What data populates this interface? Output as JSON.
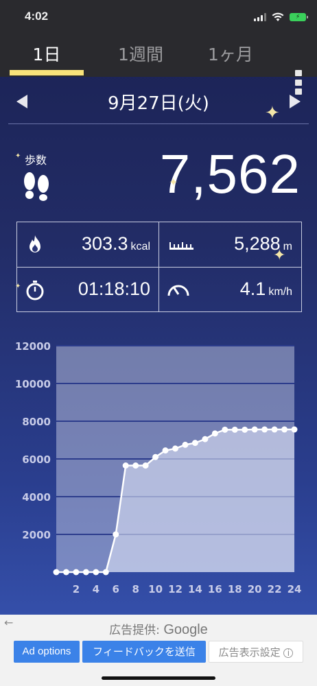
{
  "status_bar": {
    "time": "4:02"
  },
  "tabs": [
    {
      "label": "1日",
      "active": true
    },
    {
      "label": "1週間",
      "active": false
    },
    {
      "label": "1ヶ月",
      "active": false
    }
  ],
  "date": {
    "label": "9月27日(火)"
  },
  "steps": {
    "label": "歩数",
    "value": "7,562"
  },
  "stats": {
    "calories": {
      "value": "303.3",
      "unit": "kcal"
    },
    "distance": {
      "value": "5,288",
      "unit": "m"
    },
    "duration": {
      "value": "01:18:10"
    },
    "speed": {
      "value": "4.1",
      "unit": "km/h"
    }
  },
  "chart_data": {
    "type": "area",
    "x": [
      0,
      1,
      2,
      3,
      4,
      5,
      6,
      7,
      8,
      9,
      10,
      11,
      12,
      13,
      14,
      15,
      16,
      17,
      18,
      19,
      20,
      21,
      22,
      23,
      24
    ],
    "values": [
      0,
      0,
      0,
      0,
      0,
      0,
      2000,
      5650,
      5650,
      5650,
      6100,
      6450,
      6550,
      6750,
      6850,
      7050,
      7350,
      7550,
      7550,
      7550,
      7562,
      7562,
      7562,
      7562,
      7562
    ],
    "x_ticks": [
      "2",
      "4",
      "6",
      "8",
      "10",
      "12",
      "14",
      "16",
      "18",
      "20",
      "22",
      "24"
    ],
    "x_tick_values": [
      2,
      4,
      6,
      8,
      10,
      12,
      14,
      16,
      18,
      20,
      22,
      24
    ],
    "y_ticks": [
      "12000",
      "10000",
      "8000",
      "6000",
      "4000",
      "2000"
    ],
    "y_tick_values": [
      12000,
      10000,
      8000,
      6000,
      4000,
      2000
    ],
    "ylim": [
      0,
      12000
    ],
    "xlim": [
      0,
      24
    ],
    "grid": true
  },
  "ad": {
    "provider_label": "広告提供:",
    "provider_brand": "Google",
    "options_label": "Ad options",
    "feedback_label": "フィードバックを送信",
    "settings_label": "広告表示設定"
  },
  "colors": {
    "tab_indicator": "#f8e37a",
    "ad_button": "#3b82e8",
    "battery": "#3ad05b"
  }
}
